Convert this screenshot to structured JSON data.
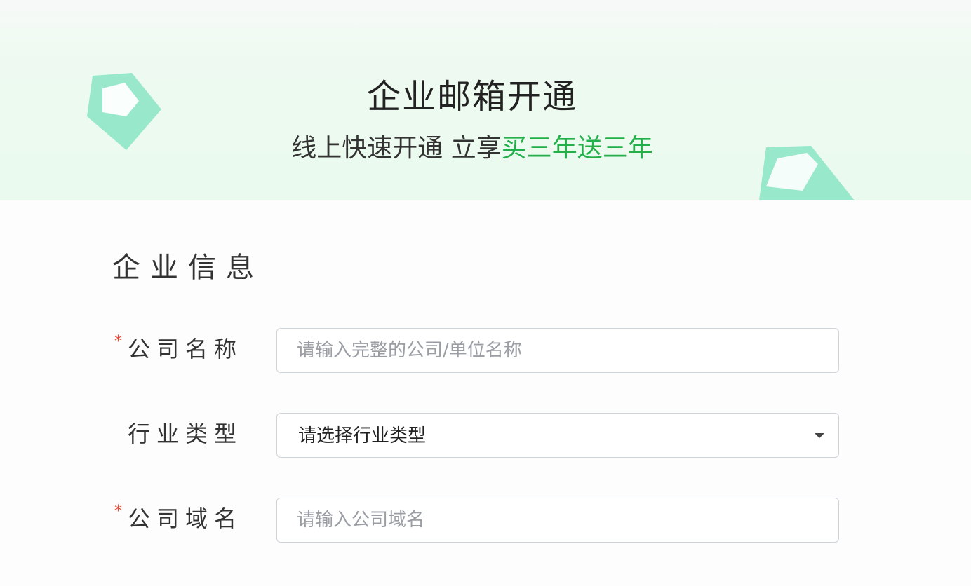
{
  "hero": {
    "title": "企业邮箱开通",
    "subtitle_plain": "线上快速开通 立享",
    "subtitle_highlight": "买三年送三年",
    "highlight_color": "#23b04a"
  },
  "section": {
    "title": "企业信息"
  },
  "form": {
    "company_name": {
      "required_mark": "*",
      "label": "公司名称",
      "value": "",
      "placeholder": "请输入完整的公司/单位名称"
    },
    "industry_type": {
      "label": "行业类型",
      "selected": "请选择行业类型",
      "icon": "caret-down-icon"
    },
    "company_domain": {
      "required_mark": "*",
      "label": "公司域名",
      "value": "",
      "placeholder": "请输入公司域名"
    }
  },
  "decorations": {
    "left_icon": "envelope-icon",
    "right_icon": "envelope-icon",
    "accent_color": "#8ce3c4"
  }
}
